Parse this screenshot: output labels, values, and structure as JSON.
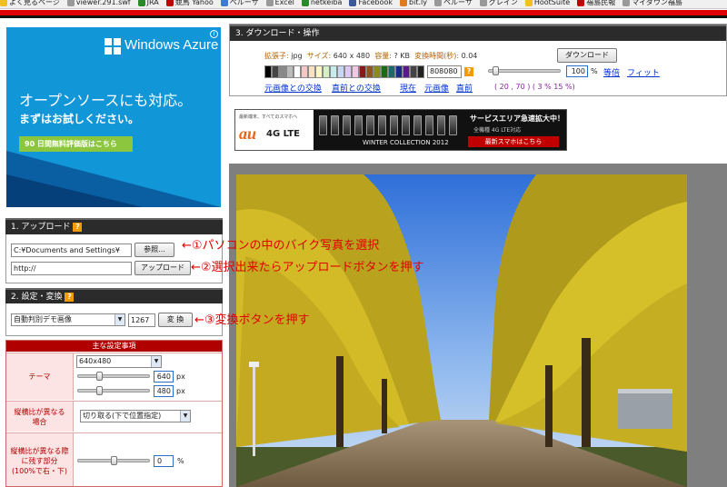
{
  "bookmarks": [
    {
      "label": "よく見るページ",
      "color": "#f0c020"
    },
    {
      "label": "viewer.291.swf",
      "color": "#999999"
    },
    {
      "label": "JRA",
      "color": "#2a8a2a"
    },
    {
      "label": "競馬 Yahoo",
      "color": "#c00000"
    },
    {
      "label": "ペルーサ",
      "color": "#3a7bd5"
    },
    {
      "label": "Excel",
      "color": "#999999"
    },
    {
      "label": "netkeiba",
      "color": "#2a8a2a"
    },
    {
      "label": "Facebook",
      "color": "#3b5998"
    },
    {
      "label": "bit.ly",
      "color": "#e07a1f"
    },
    {
      "label": "ペルーサ",
      "color": "#999999"
    },
    {
      "label": "グレイン",
      "color": "#999999"
    },
    {
      "label": "HootSuite",
      "color": "#f0c020"
    },
    {
      "label": "福島民報",
      "color": "#c00000"
    },
    {
      "label": "マイダウン福島",
      "color": "#999999"
    }
  ],
  "ad_azure": {
    "brand": "Windows Azure",
    "headline": "オープンソースにも対応。",
    "subline": "まずはお試しください。",
    "cta": "90 日間無料評価版はこちら",
    "info": "i"
  },
  "upload": {
    "title": "1. アップロード",
    "help": "?",
    "file_value": "C:¥Documents and Settings¥",
    "browse_label": "参照...",
    "url_value": "http://",
    "upload_label": "アップロード"
  },
  "convert": {
    "title": "2. 設定・変換",
    "help": "?",
    "mode_value": "自動判別デモ画像",
    "count": "1267",
    "convert_label": "変 換"
  },
  "settings": {
    "header": "主な設定事項",
    "theme_label": "テーマ",
    "size_value": "640x480",
    "width": "640",
    "height": "480",
    "unit_px": "px",
    "aspect_label": "縦横比が異なる場合",
    "aspect_value": "切り取る(下で位置指定)",
    "remain_label": "縦横比が異なる際に残す部分(100%で右・下)",
    "remain_value": "0",
    "remain_unit": "%"
  },
  "annotations": {
    "a1": "←①パソコンの中のバイク写真を選択",
    "a2": "←②選択出来たらアップロードボタンを押す",
    "a3": "←③変換ボタンを押す"
  },
  "download": {
    "title": "3. ダウンロード・操作",
    "ext_label": "拡張子:",
    "ext_value": "jpg",
    "size_label": "サイズ:",
    "size_value": "640 x 480",
    "cap_label": "容量:",
    "cap_value": "? KB",
    "time_label": "変換時間(秒):",
    "time_value": "0.04",
    "download_label": "ダウンロード",
    "color_value": "808080",
    "help": "?",
    "zoom_value": "100",
    "zoom_unit": "%",
    "link_equal": "等倍",
    "link_fit": "フィット",
    "link_revert_original": "元画像との交換",
    "link_revert_prev": "直前との交換",
    "link_current": "現在",
    "link_original": "元画像",
    "link_prev": "直前",
    "coords": "( 20 , 70 ) ( 3 % 15 %)",
    "swatches": [
      "#000000",
      "#444444",
      "#888888",
      "#bbbbbb",
      "#ffffff",
      "#f4c6c6",
      "#f6e2c2",
      "#fbf7c4",
      "#d6f0c6",
      "#c8ecec",
      "#c8d6f2",
      "#dcc8f0",
      "#f0c8e6",
      "#8a1a1a",
      "#8a5a1a",
      "#8a8a1a",
      "#1a6a1a",
      "#1a6a6a",
      "#1a2a8a",
      "#5a1a8a",
      "#444444",
      "#222222"
    ]
  },
  "ad_au": {
    "brand": "au",
    "lte": "4G LTE",
    "tagline": "最新端末、すべてのスマホへ",
    "collection": "WINTER COLLECTION 2012",
    "r1": "サービスエリア急速拡大中！",
    "r2": "全機種 4G LTE対応",
    "r3": "最新スマホはこちら"
  }
}
